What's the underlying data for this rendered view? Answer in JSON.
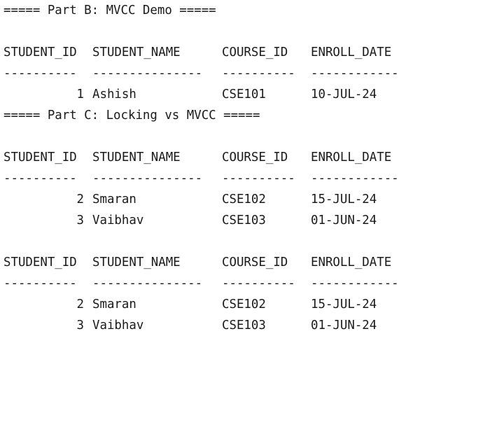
{
  "partB": {
    "header": "===== Part B: MVCC Demo =====",
    "columns": [
      "STUDENT_ID",
      "STUDENT_NAME",
      "COURSE_ID",
      "ENROLL_DATE"
    ],
    "separators": [
      "----------",
      "---------------",
      "----------",
      "------------"
    ],
    "rows": [
      [
        "1",
        "Ashish",
        "CSE101",
        "10-JUL-24"
      ]
    ]
  },
  "partC": {
    "header": "===== Part C: Locking vs MVCC =====",
    "result1": {
      "columns": [
        "STUDENT_ID",
        "STUDENT_NAME",
        "COURSE_ID",
        "ENROLL_DATE"
      ],
      "separators": [
        "----------",
        "---------------",
        "----------",
        "------------"
      ],
      "rows": [
        [
          "2",
          "Smaran",
          "CSE102",
          "15-JUL-24"
        ],
        [
          "3",
          "Vaibhav",
          "CSE103",
          "01-JUN-24"
        ]
      ]
    },
    "result2": {
      "columns": [
        "STUDENT_ID",
        "STUDENT_NAME",
        "COURSE_ID",
        "ENROLL_DATE"
      ],
      "separators": [
        "----------",
        "---------------",
        "----------",
        "------------"
      ],
      "rows": [
        [
          "2",
          "Smaran",
          "CSE102",
          "15-JUL-24"
        ],
        [
          "3",
          "Vaibhav",
          "CSE103",
          "01-JUN-24"
        ]
      ]
    }
  }
}
